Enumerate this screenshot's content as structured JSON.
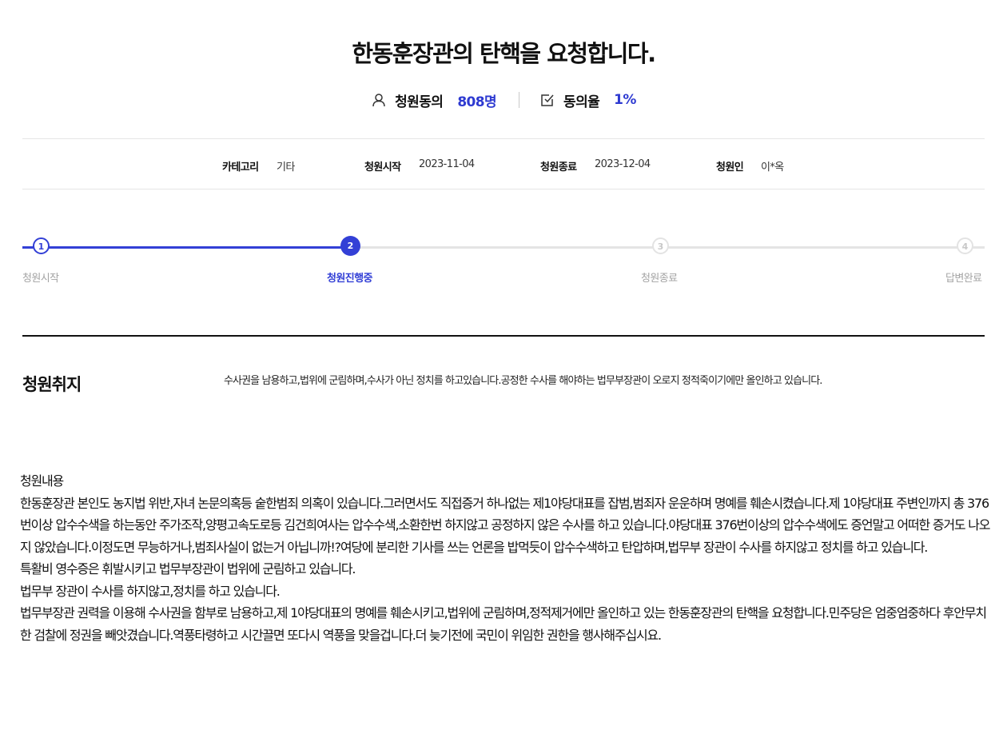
{
  "title": "한동훈장관의 탄핵을 요청합니다.",
  "stats": {
    "agree_label": "청원동의",
    "agree_count": "808명",
    "rate_label": "동의율",
    "rate_value": "1%"
  },
  "meta": {
    "category_label": "카테고리",
    "category_value": "기타",
    "start_label": "청원시작",
    "start_value": "2023-11-04",
    "end_label": "청원종료",
    "end_value": "2023-12-04",
    "petitioner_label": "청원인",
    "petitioner_value": "이*옥"
  },
  "progress": {
    "current_step": 2,
    "steps": [
      {
        "number": "1",
        "label": "청원시작",
        "state": "done"
      },
      {
        "number": "2",
        "label": "청원진행중",
        "state": "current"
      },
      {
        "number": "3",
        "label": "청원종료",
        "state": "todo"
      },
      {
        "number": "4",
        "label": "답변완료",
        "state": "todo"
      }
    ]
  },
  "purpose": {
    "heading": "청원취지",
    "text": "수사권을 남용하고,법위에 군림하며,수사가 아닌 정치를 하고있습니다.공정한 수사를 해야하는 법무부장관이 오로지 정적죽이기에만 올인하고 있습니다."
  },
  "content": {
    "heading": "청원내용",
    "paragraphs": [
      "한동훈장관 본인도 농지법 위반,자녀 논문의혹등 숱한범죄 의혹이 있습니다.그러면서도 직접증거 하나없는 제1야당대표를 잡범,범죄자 운운하며 명예를 훼손시켰습니다.제 1야당대표 주변인까지 총 376번이상 압수수색을 하는동안 주가조작,양평고속도로등 김건희여사는 압수수색,소환한번 하지않고 공정하지 않은 수사를 하고 있습니다.야당대표 376번이상의 압수수색에도 증언말고 어떠한 증거도 나오지 않았습니다.이정도면 무능하거나,범죄사실이 없는거 아닙니까!?여당에 분리한 기사를 쓰는 언론을 밥먹듯이 압수수색하고 탄압하며,법무부 장관이 수사를 하지않고 정치를 하고 있습니다.",
      "특활비 영수증은 휘발시키고 법무부장관이 법위에 군림하고 있습니다.",
      "법무부 장관이 수사를 하지않고,정치를 하고 있습니다.",
      "법무부장관 권력을 이용해 수사권을 함부로 남용하고,제 1야당대표의 명예를 훼손시키고,법위에 군림하며,정적제거에만 올인하고 있는 한동훈장관의 탄핵을 요청합니다.민주당은 엄중엄중하다 후안무치한 검찰에 정권을 빼앗겼습니다.역풍타령하고 시간끌면 또다시 역풍을 맞을겁니다.더 늦기전에 국민이 위임한 권한을 행사해주십시요."
    ]
  },
  "colors": {
    "accent": "#3340d6",
    "text": "#111111",
    "muted": "#a3a3a3"
  },
  "icons": {
    "agree": "person-icon",
    "rate": "checkbox-icon"
  }
}
